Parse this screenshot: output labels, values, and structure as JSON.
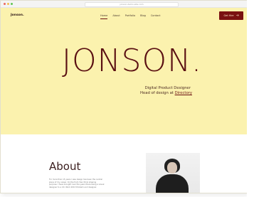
{
  "browser": {
    "url": "jonson.demo.site.com"
  },
  "header": {
    "brand": "Jonson.",
    "nav": [
      {
        "label": "Home",
        "active": true
      },
      {
        "label": "About",
        "active": false
      },
      {
        "label": "Portfolio",
        "active": false
      },
      {
        "label": "Blog",
        "active": false
      },
      {
        "label": "Contact",
        "active": false
      }
    ],
    "cta": {
      "label": "Get Hire",
      "icon": "arrow-right-icon"
    }
  },
  "hero": {
    "title": "JONSON.",
    "role_line1": "Digital Product Designer",
    "role_line2_prefix": "Head of design at",
    "role_link": "Directory"
  },
  "about": {
    "title": "About",
    "text": "For more than 15 years I was design has been the central place of my career. On the fruit chan think shaping purpose. I have brought over the years there being a visual designer to a UX. Work 2013 Problem and designer."
  },
  "colors": {
    "hero_bg": "#fbf2ae",
    "accent": "#7a1111",
    "title": "#5a0f12"
  }
}
